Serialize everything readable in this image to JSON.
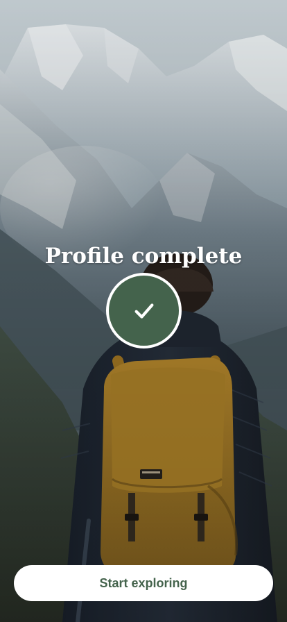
{
  "screen": {
    "title": "Profile complete",
    "status_icon": "checkmark-icon",
    "accent_color": "#44634c"
  },
  "actions": {
    "primary_label": "Start exploring"
  },
  "background": {
    "image_subject": "hiker-with-backpack-facing-mountains"
  }
}
